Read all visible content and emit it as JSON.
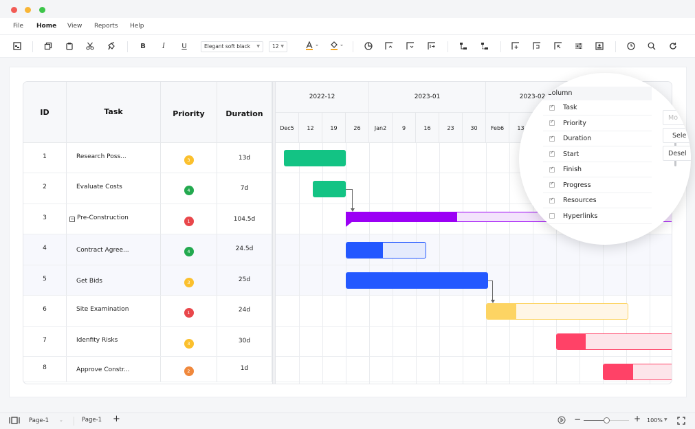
{
  "window": {
    "traffic_lights": [
      "#f25b55",
      "#f8b536",
      "#3dc54a"
    ]
  },
  "menu": {
    "items": [
      {
        "label": "File",
        "active": false
      },
      {
        "label": "Home",
        "active": true
      },
      {
        "label": "View",
        "active": false
      },
      {
        "label": "Reports",
        "active": false
      },
      {
        "label": "Help",
        "active": false
      }
    ]
  },
  "toolbar": {
    "font_family": "Elegant soft black",
    "font_size": "12",
    "bold": "B",
    "italic": "I",
    "underline": "U",
    "font_color_accent": "#f5a623",
    "fill_color_accent": "#f5a623"
  },
  "table": {
    "headers": {
      "id": "ID",
      "task": "Task",
      "priority": "Priority",
      "duration": "Duration"
    },
    "rows": [
      {
        "id": "1",
        "task": "Research Poss...",
        "priority": "3",
        "duration": "13d",
        "collapsible": false
      },
      {
        "id": "2",
        "task": "Evaluate Costs",
        "priority": "4",
        "duration": "7d",
        "collapsible": false
      },
      {
        "id": "3",
        "task": "Pre-Construction",
        "priority": "1",
        "duration": "104.5d",
        "collapsible": true
      },
      {
        "id": "4",
        "task": "Contract Agree...",
        "priority": "4",
        "duration": "24.5d",
        "collapsible": false
      },
      {
        "id": "5",
        "task": "Get Bids",
        "priority": "3",
        "duration": "25d",
        "collapsible": false
      },
      {
        "id": "6",
        "task": "Site Examination",
        "priority": "1",
        "duration": "24d",
        "collapsible": false
      },
      {
        "id": "7",
        "task": "Idenfity Risks",
        "priority": "3",
        "duration": "30d",
        "collapsible": false
      },
      {
        "id": "8",
        "task": "Approve Constr...",
        "priority": "2",
        "duration": "1d",
        "collapsible": false
      }
    ]
  },
  "priority_colors": {
    "1": "#e9474b",
    "2": "#f0883c",
    "3": "#fbc02d",
    "4": "#23a94f"
  },
  "timeline": {
    "months": [
      {
        "label": "2022-12",
        "weeks": 4
      },
      {
        "label": "2023-01",
        "weeks": 5
      },
      {
        "label": "2023-02",
        "weeks": 4
      }
    ],
    "weeks": [
      "Dec5",
      "12",
      "19",
      "26",
      "Jan2",
      "9",
      "16",
      "23",
      "30",
      "Feb6",
      "13",
      "",
      "",
      "",
      "",
      "",
      ""
    ],
    "bars": [
      {
        "row": 0,
        "start_week": 0.35,
        "length_weeks": 2.65,
        "progress": 1.0,
        "color": "#13c384",
        "light": "#13c384",
        "type": "task"
      },
      {
        "row": 1,
        "start_week": 1.6,
        "length_weeks": 1.4,
        "progress": 1.0,
        "color": "#13c384",
        "light": "#13c384",
        "type": "task"
      },
      {
        "row": 2,
        "start_week": 3.0,
        "length_weeks": 14.0,
        "progress": 0.34,
        "color": "#9b00f5",
        "light": "#f3e3fc",
        "type": "summary"
      },
      {
        "row": 3,
        "start_week": 3.0,
        "length_weeks": 3.45,
        "progress": 0.46,
        "color": "#2358ff",
        "light": "#e5ebfd",
        "type": "task"
      },
      {
        "row": 4,
        "start_week": 3.0,
        "length_weeks": 6.1,
        "progress": 1.0,
        "color": "#2358ff",
        "light": "#2358ff",
        "type": "task"
      },
      {
        "row": 5,
        "start_week": 9.0,
        "length_weeks": 6.1,
        "progress": 0.21,
        "color": "#fdd463",
        "light": "#fff6e6",
        "type": "task"
      },
      {
        "row": 6,
        "start_week": 12.0,
        "length_weeks": 5.0,
        "progress": 0.25,
        "color": "#ff4267",
        "light": "#fde5ea",
        "type": "task"
      },
      {
        "row": 7,
        "start_week": 14.0,
        "length_weeks": 3.0,
        "progress": 0.43,
        "color": "#ff4267",
        "light": "#fde5ea",
        "type": "task"
      }
    ],
    "dependencies": [
      {
        "from_row": 1,
        "to_row": 2
      },
      {
        "from_row": 4,
        "to_row": 5
      }
    ]
  },
  "column_panel": {
    "title": "Column",
    "options": [
      {
        "label": "Task",
        "checked": true
      },
      {
        "label": "Priority",
        "checked": true
      },
      {
        "label": "Duration",
        "checked": true
      },
      {
        "label": "Start",
        "checked": true
      },
      {
        "label": "Finish",
        "checked": true
      },
      {
        "label": "Progress",
        "checked": true
      },
      {
        "label": "Resources",
        "checked": true
      },
      {
        "label": "Hyperlinks",
        "checked": false
      }
    ],
    "side_buttons": [
      "Mo",
      "Sele",
      "Desel"
    ]
  },
  "bottom": {
    "page_select": "Page-1",
    "page_tab": "Page-1",
    "add_page": "+",
    "zoom_minus": "−",
    "zoom_plus": "+",
    "zoom_level": "100%",
    "zoom_fraction": 0.5
  }
}
